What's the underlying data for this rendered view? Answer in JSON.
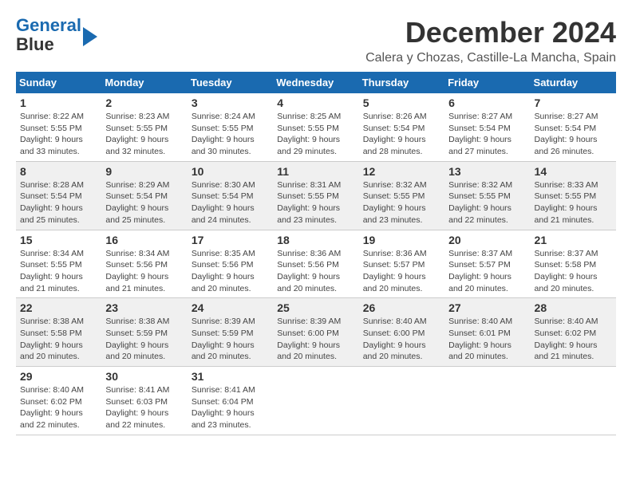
{
  "logo": {
    "line1": "General",
    "line2": "Blue"
  },
  "title": "December 2024",
  "location": "Calera y Chozas, Castille-La Mancha, Spain",
  "headers": [
    "Sunday",
    "Monday",
    "Tuesday",
    "Wednesday",
    "Thursday",
    "Friday",
    "Saturday"
  ],
  "weeks": [
    [
      {
        "day": "1",
        "info": "Sunrise: 8:22 AM\nSunset: 5:55 PM\nDaylight: 9 hours and 33 minutes."
      },
      {
        "day": "2",
        "info": "Sunrise: 8:23 AM\nSunset: 5:55 PM\nDaylight: 9 hours and 32 minutes."
      },
      {
        "day": "3",
        "info": "Sunrise: 8:24 AM\nSunset: 5:55 PM\nDaylight: 9 hours and 30 minutes."
      },
      {
        "day": "4",
        "info": "Sunrise: 8:25 AM\nSunset: 5:55 PM\nDaylight: 9 hours and 29 minutes."
      },
      {
        "day": "5",
        "info": "Sunrise: 8:26 AM\nSunset: 5:54 PM\nDaylight: 9 hours and 28 minutes."
      },
      {
        "day": "6",
        "info": "Sunrise: 8:27 AM\nSunset: 5:54 PM\nDaylight: 9 hours and 27 minutes."
      },
      {
        "day": "7",
        "info": "Sunrise: 8:27 AM\nSunset: 5:54 PM\nDaylight: 9 hours and 26 minutes."
      }
    ],
    [
      {
        "day": "8",
        "info": "Sunrise: 8:28 AM\nSunset: 5:54 PM\nDaylight: 9 hours and 25 minutes."
      },
      {
        "day": "9",
        "info": "Sunrise: 8:29 AM\nSunset: 5:54 PM\nDaylight: 9 hours and 25 minutes."
      },
      {
        "day": "10",
        "info": "Sunrise: 8:30 AM\nSunset: 5:54 PM\nDaylight: 9 hours and 24 minutes."
      },
      {
        "day": "11",
        "info": "Sunrise: 8:31 AM\nSunset: 5:55 PM\nDaylight: 9 hours and 23 minutes."
      },
      {
        "day": "12",
        "info": "Sunrise: 8:32 AM\nSunset: 5:55 PM\nDaylight: 9 hours and 23 minutes."
      },
      {
        "day": "13",
        "info": "Sunrise: 8:32 AM\nSunset: 5:55 PM\nDaylight: 9 hours and 22 minutes."
      },
      {
        "day": "14",
        "info": "Sunrise: 8:33 AM\nSunset: 5:55 PM\nDaylight: 9 hours and 21 minutes."
      }
    ],
    [
      {
        "day": "15",
        "info": "Sunrise: 8:34 AM\nSunset: 5:55 PM\nDaylight: 9 hours and 21 minutes."
      },
      {
        "day": "16",
        "info": "Sunrise: 8:34 AM\nSunset: 5:56 PM\nDaylight: 9 hours and 21 minutes."
      },
      {
        "day": "17",
        "info": "Sunrise: 8:35 AM\nSunset: 5:56 PM\nDaylight: 9 hours and 20 minutes."
      },
      {
        "day": "18",
        "info": "Sunrise: 8:36 AM\nSunset: 5:56 PM\nDaylight: 9 hours and 20 minutes."
      },
      {
        "day": "19",
        "info": "Sunrise: 8:36 AM\nSunset: 5:57 PM\nDaylight: 9 hours and 20 minutes."
      },
      {
        "day": "20",
        "info": "Sunrise: 8:37 AM\nSunset: 5:57 PM\nDaylight: 9 hours and 20 minutes."
      },
      {
        "day": "21",
        "info": "Sunrise: 8:37 AM\nSunset: 5:58 PM\nDaylight: 9 hours and 20 minutes."
      }
    ],
    [
      {
        "day": "22",
        "info": "Sunrise: 8:38 AM\nSunset: 5:58 PM\nDaylight: 9 hours and 20 minutes."
      },
      {
        "day": "23",
        "info": "Sunrise: 8:38 AM\nSunset: 5:59 PM\nDaylight: 9 hours and 20 minutes."
      },
      {
        "day": "24",
        "info": "Sunrise: 8:39 AM\nSunset: 5:59 PM\nDaylight: 9 hours and 20 minutes."
      },
      {
        "day": "25",
        "info": "Sunrise: 8:39 AM\nSunset: 6:00 PM\nDaylight: 9 hours and 20 minutes."
      },
      {
        "day": "26",
        "info": "Sunrise: 8:40 AM\nSunset: 6:00 PM\nDaylight: 9 hours and 20 minutes."
      },
      {
        "day": "27",
        "info": "Sunrise: 8:40 AM\nSunset: 6:01 PM\nDaylight: 9 hours and 20 minutes."
      },
      {
        "day": "28",
        "info": "Sunrise: 8:40 AM\nSunset: 6:02 PM\nDaylight: 9 hours and 21 minutes."
      }
    ],
    [
      {
        "day": "29",
        "info": "Sunrise: 8:40 AM\nSunset: 6:02 PM\nDaylight: 9 hours and 22 minutes."
      },
      {
        "day": "30",
        "info": "Sunrise: 8:41 AM\nSunset: 6:03 PM\nDaylight: 9 hours and 22 minutes."
      },
      {
        "day": "31",
        "info": "Sunrise: 8:41 AM\nSunset: 6:04 PM\nDaylight: 9 hours and 23 minutes."
      },
      {
        "day": "",
        "info": ""
      },
      {
        "day": "",
        "info": ""
      },
      {
        "day": "",
        "info": ""
      },
      {
        "day": "",
        "info": ""
      }
    ]
  ]
}
